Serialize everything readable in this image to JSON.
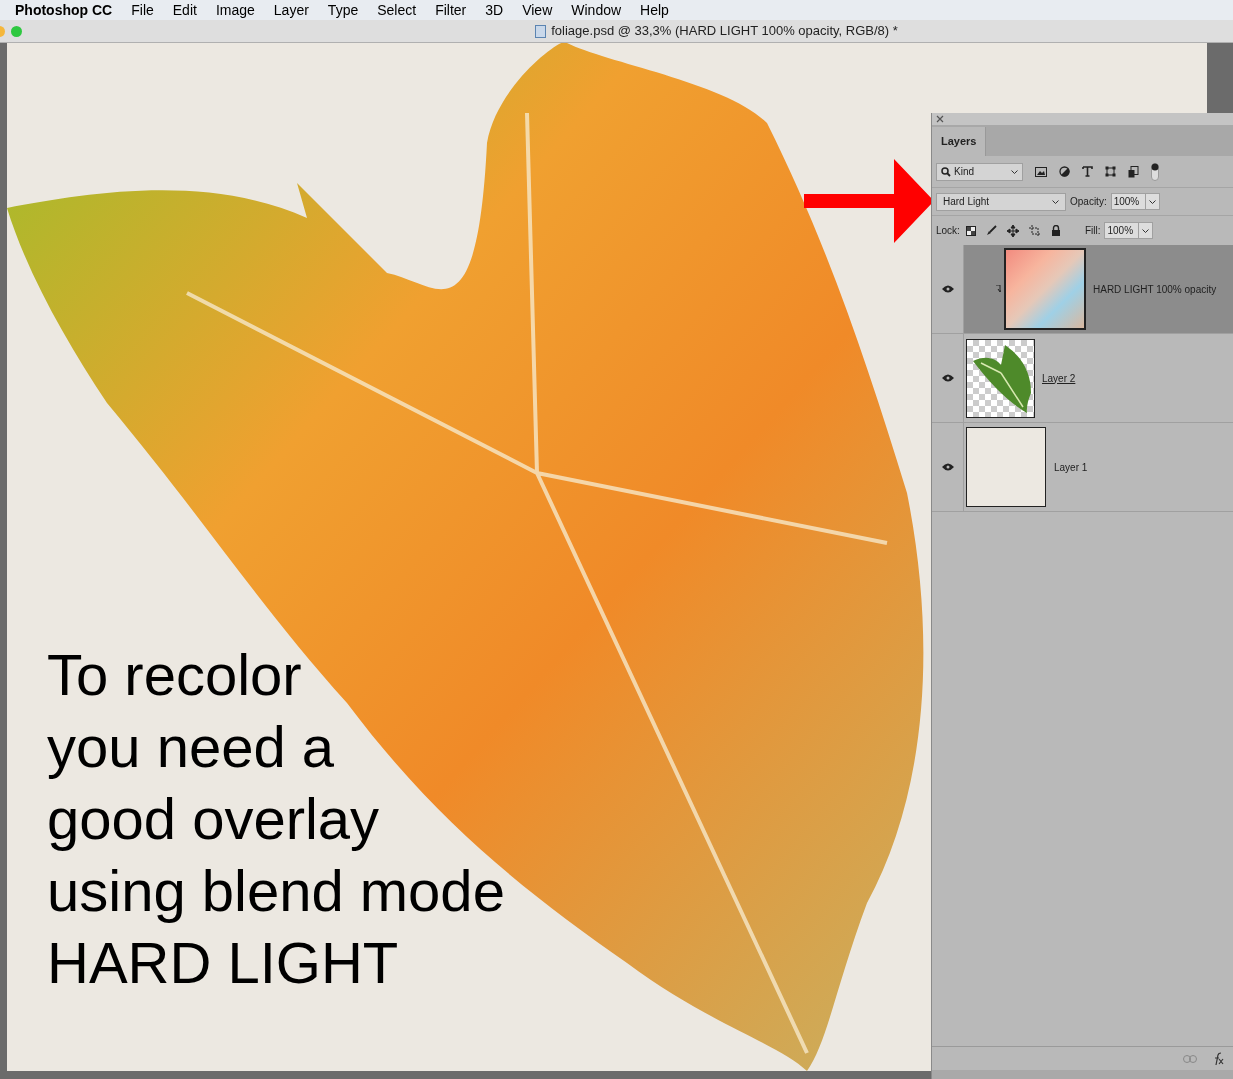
{
  "menu_bar": {
    "app_name": "Photoshop CC",
    "items": [
      "File",
      "Edit",
      "Image",
      "Layer",
      "Type",
      "Select",
      "Filter",
      "3D",
      "View",
      "Window",
      "Help"
    ]
  },
  "document": {
    "title": "foliage.psd @ 33,3% (HARD LIGHT 100% opacity, RGB/8) *"
  },
  "canvas": {
    "caption": "To recolor\nyou need a\ngood overlay\nusing blend mode\nHARD LIGHT"
  },
  "layers_panel": {
    "tabs": [
      {
        "label": "Layers",
        "selected": true
      }
    ],
    "filter": "Kind",
    "blend_mode": "Hard Light",
    "opacity_label": "Opacity:",
    "opacity": "100%",
    "lock_label": "Lock:",
    "fill_label": "Fill:",
    "fill": "100%",
    "layers": [
      {
        "name": "HARD LIGHT 100% opacity",
        "kind": "overlay",
        "selected": true,
        "visible": true,
        "clipped": true,
        "clip_base": false
      },
      {
        "name": "Layer 2",
        "kind": "leaf",
        "selected": false,
        "visible": true,
        "clipped": false,
        "clip_base": true
      },
      {
        "name": "Layer 1",
        "kind": "fill",
        "selected": false,
        "visible": true,
        "clipped": false,
        "clip_base": false
      }
    ]
  }
}
